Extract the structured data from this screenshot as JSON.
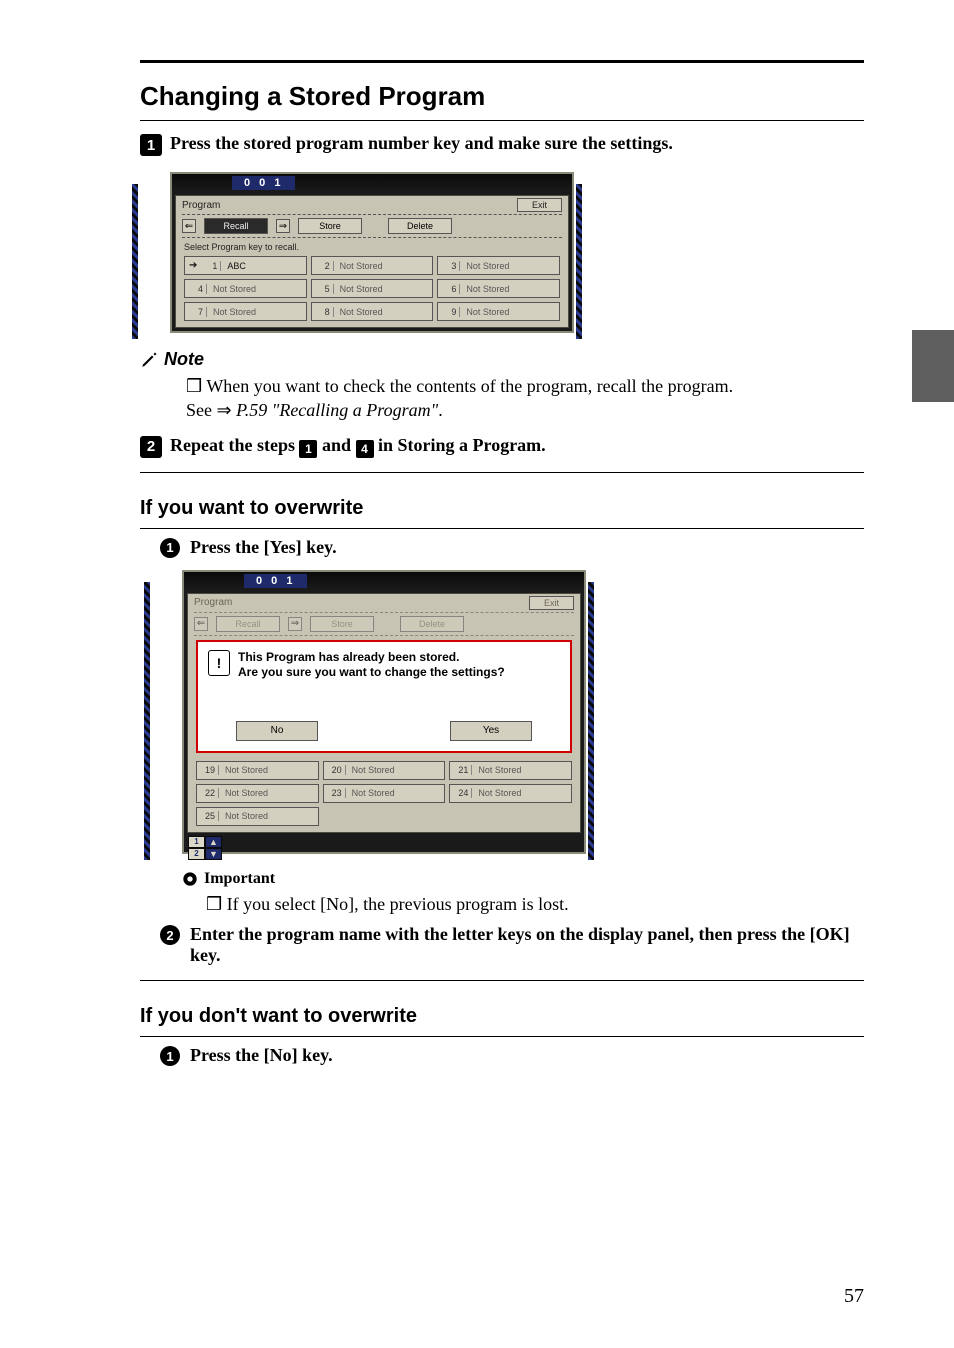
{
  "section": {
    "title": "Changing a Stored Program"
  },
  "step1": {
    "text": "Press the stored program number key and make sure the settings."
  },
  "note1": {
    "label": "Note",
    "line": "When you want to check the contents of the program, recall the program.",
    "see": "See",
    "ref_arrow": "⇒",
    "ref": "P.59 \"Recalling a Program\""
  },
  "step2": {
    "prefix": "Repeat the steps ",
    "mid": " and ",
    "suffix": " in Storing a Program.",
    "a": "1",
    "b": "4"
  },
  "overwrite": {
    "title": "If you want to overwrite",
    "sub1_prefix": "Press the ",
    "sub1_key": "[Yes]",
    "sub1_suffix": " key.",
    "important_label": "Important",
    "important_body_pre": "If you select ",
    "important_key": "[No]",
    "important_body_post": ", the previous program is lost.",
    "sub2_a": "Enter the program name with the letter keys on the display panel, then press the ",
    "sub2_key": "[OK]",
    "sub2_b": " key."
  },
  "noover": {
    "title": "If you don't want to overwrite",
    "sub1_prefix": "Press the ",
    "sub1_key": "[No]",
    "sub1_suffix": " key."
  },
  "page_number": "57",
  "screenshot1": {
    "counter": "0 0 1",
    "panel_title": "Program",
    "exit": "Exit",
    "recall": "Recall",
    "store": "Store",
    "delete": "Delete",
    "hint": "Select Program key to recall.",
    "slots": [
      {
        "n": "1",
        "label": "ABC",
        "stored": true,
        "arrow": true
      },
      {
        "n": "2",
        "label": "Not Stored"
      },
      {
        "n": "3",
        "label": "Not Stored"
      },
      {
        "n": "4",
        "label": "Not Stored"
      },
      {
        "n": "5",
        "label": "Not Stored"
      },
      {
        "n": "6",
        "label": "Not Stored"
      },
      {
        "n": "7",
        "label": "Not Stored"
      },
      {
        "n": "8",
        "label": "Not Stored"
      },
      {
        "n": "9",
        "label": "Not Stored"
      }
    ]
  },
  "screenshot2": {
    "counter": "0 0 1",
    "panel_title": "Program",
    "exit": "Exit",
    "recall": "Recall",
    "store": "Store",
    "delete": "Delete",
    "dialog_line1": "This Program has already been stored.",
    "dialog_line2": "Are you sure you want to change the settings?",
    "no": "No",
    "yes": "Yes",
    "slots": [
      {
        "n": "19",
        "label": "Not Stored"
      },
      {
        "n": "20",
        "label": "Not Stored"
      },
      {
        "n": "21",
        "label": "Not Stored"
      },
      {
        "n": "22",
        "label": "Not Stored"
      },
      {
        "n": "23",
        "label": "Not Stored"
      },
      {
        "n": "24",
        "label": "Not Stored"
      },
      {
        "n": "25",
        "label": "Not Stored"
      }
    ],
    "pager": {
      "current": "1",
      "total": "2"
    }
  }
}
